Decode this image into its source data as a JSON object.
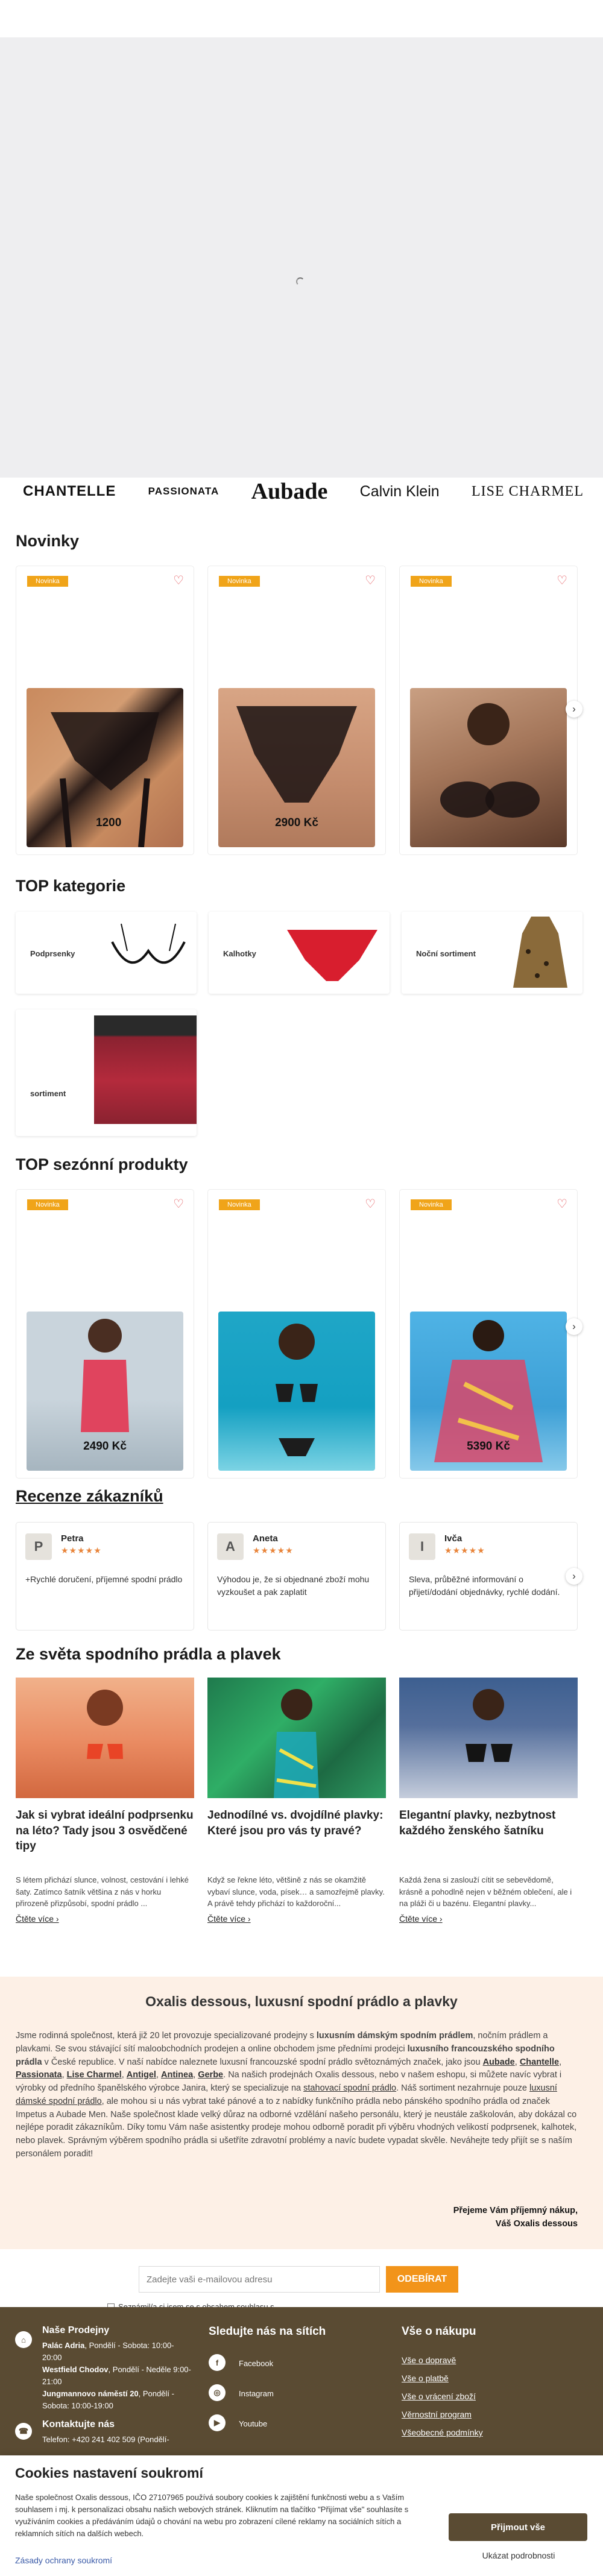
{
  "brands": [
    "CHANTELLE",
    "PASSIONATA",
    "Aubade",
    "Calvin Klein",
    "LISE CHARMEL"
  ],
  "novinky": {
    "title": "Novinky",
    "products": [
      {
        "badge": "Novinka",
        "price": "1200"
      },
      {
        "badge": "Novinka",
        "price": "2900 Kč"
      },
      {
        "badge": "Novinka",
        "price": ""
      }
    ]
  },
  "top_kategorie": {
    "title": "TOP kategorie",
    "items": [
      {
        "label": "Podprsenky"
      },
      {
        "label": "Kalhotky"
      },
      {
        "label": "Noční sortiment"
      },
      {
        "label": "sortiment"
      }
    ]
  },
  "top_sezonni": {
    "title": "TOP sezónní produkty",
    "products": [
      {
        "badge": "Novinka",
        "price": "2490 Kč"
      },
      {
        "badge": "Novinka",
        "price": ""
      },
      {
        "badge": "Novinka",
        "price": "5390 Kč"
      }
    ]
  },
  "reviews": {
    "title": "Recenze zákazníků",
    "items": [
      {
        "initial": "P",
        "name": "Petra",
        "stars": "★★★★★",
        "text": "+Rychlé doručení, příjemné spodní prádlo"
      },
      {
        "initial": "A",
        "name": "Aneta",
        "stars": "★★★★★",
        "text": "Výhodou je, že si objednané zboží mohu vyzkoušet a pak zaplatit"
      },
      {
        "initial": "I",
        "name": "Ivča",
        "stars": "★★★★★",
        "text": "Sleva, průběžné informování o přijetí/dodání objednávky, rychlé dodání."
      }
    ]
  },
  "blog": {
    "title": "Ze světa spodního prádla a plavek",
    "more_label": "Čtěte více",
    "articles": [
      {
        "title": "Jak si vybrat ideální podprsenku na léto? Tady jsou 3 osvědčené tipy",
        "text": "S létem přichází slunce, volnost, cestování i lehké šaty. Zatímco šatník většina z nás v horku přirozeně přizpůsobí, spodní prádlo ..."
      },
      {
        "title": "Jednodílné vs. dvojdílné plavky: Které jsou pro vás ty pravé?",
        "text": "Když se řekne léto, většině z nás se okamžitě vybaví slunce, voda, písek… a samozřejmě plavky. A právě tehdy přichází to každoroční..."
      },
      {
        "title": "Elegantní plavky, nezbytnost každého ženského šatníku",
        "text": "Každá žena si zaslouží cítit se sebevědomě, krásně a pohodlně nejen v běžném oblečení, ale i na pláži či u bazénu. Elegantní plavky..."
      }
    ]
  },
  "about": {
    "title": "Oxalis dessous, luxusní spodní prádlo a plavky",
    "p1": "Jsme rodinná společnost, která již 20 let provozuje specializované prodejny s ",
    "b1": "luxusním dámským spodním prádlem",
    "p2": ", nočním prádlem a plavkami. Se svou stávající sítí maloobchodních prodejen a online obchodem jsme předními prodejci ",
    "b2": "luxusního francouzského spodního prádla",
    "p3": " v České republice. V naší nabídce naleznete luxusní francouzské spodní prádlo světoznámých značek, jako jsou ",
    "brand_links": [
      "Aubade",
      "Chantelle",
      "Passionata",
      "Lise Charmel",
      "Antigel",
      "Antinea",
      "Gerbe"
    ],
    "p4": ". Na našich prodejnách Oxalis dessous, nebo v našem eshopu, si můžete navíc vybrat i výrobky od předního španělského výrobce Janira, který se specializuje na ",
    "link1": "stahovací spodní prádlo",
    "p5": ". Náš sortiment nezahrnuje pouze ",
    "link2": "luxusní dámské spodní prádlo",
    "p6": ", ale mohou si u nás vybrat také pánové a to z nabídky funkčního prádla nebo pánského spodního prádla od značek Impetus a Aubade Men. Naše společnost klade velký důraz na odborné vzdělání našeho personálu, který je neustále zaškolován, aby dokázal co nejlépe poradit zákazníkům. Díky tomu Vám naše asistentky prodeje mohou odborně poradit při výběru vhodných velikostí podprsenek, kalhotek, nebo plavek. Správným výběrem spodního prádla si ušetříte zdravotní problémy a navíc budete vypadat skvěle. Neváhejte tedy přijít se s naším personálem poradit!",
    "sig1": "Přejeme Vám příjemný nákup,",
    "sig2": "Váš Oxalis dessous"
  },
  "newsletter": {
    "placeholder": "Zadejte vaši e-mailovou adresu",
    "button": "ODEBÍRAT",
    "consent": "Seznámil/a si jsem se s obsahem souhlasu s ..."
  },
  "footer": {
    "stores_title": "Naše Prodejny",
    "stores": [
      {
        "name": "Palác Adria",
        "hours": ", Pondělí - Sobota: 10:00-20:00"
      },
      {
        "name": "Westfield Chodov",
        "hours": ", Pondělí - Neděle 9:00-21:00"
      },
      {
        "name": "Jungmannovo náměstí 20",
        "hours": ", Pondělí - Sobota: 10:00-19:00"
      }
    ],
    "contact_title": "Kontaktujte nás",
    "contact_phone": "Telefon: +420 241 402 509 (Pondělí-",
    "social_title": "Sledujte nás na sítích",
    "social": [
      "Facebook",
      "Instagram",
      "Youtube"
    ],
    "shop_title": "Vše o nákupu",
    "shop_links": [
      "Vše o dopravě",
      "Vše o platbě",
      "Vše o vrácení zboží",
      "Věrnostní program",
      "Všeobecné podmínky"
    ]
  },
  "cookie": {
    "title": "Cookies nastavení soukromí",
    "text": "Naše společnost Oxalis dessous, IČO 27107965 používá soubory cookies k zajištění funkčnosti webu a s Vaším souhlasem i mj. k personalizaci obsahu našich webových stránek. Kliknutím na tlačítko \"Přijímat vše\" souhlasíte s využíváním cookies a předáváním údajů o chování na webu pro zobrazení cílené reklamy na sociálních sítích a reklamních sítích na dalších webech.",
    "privacy_link": "Zásady ochrany soukromí",
    "accept": "Přijmout vše",
    "details": "Ukázat podrobnosti"
  }
}
